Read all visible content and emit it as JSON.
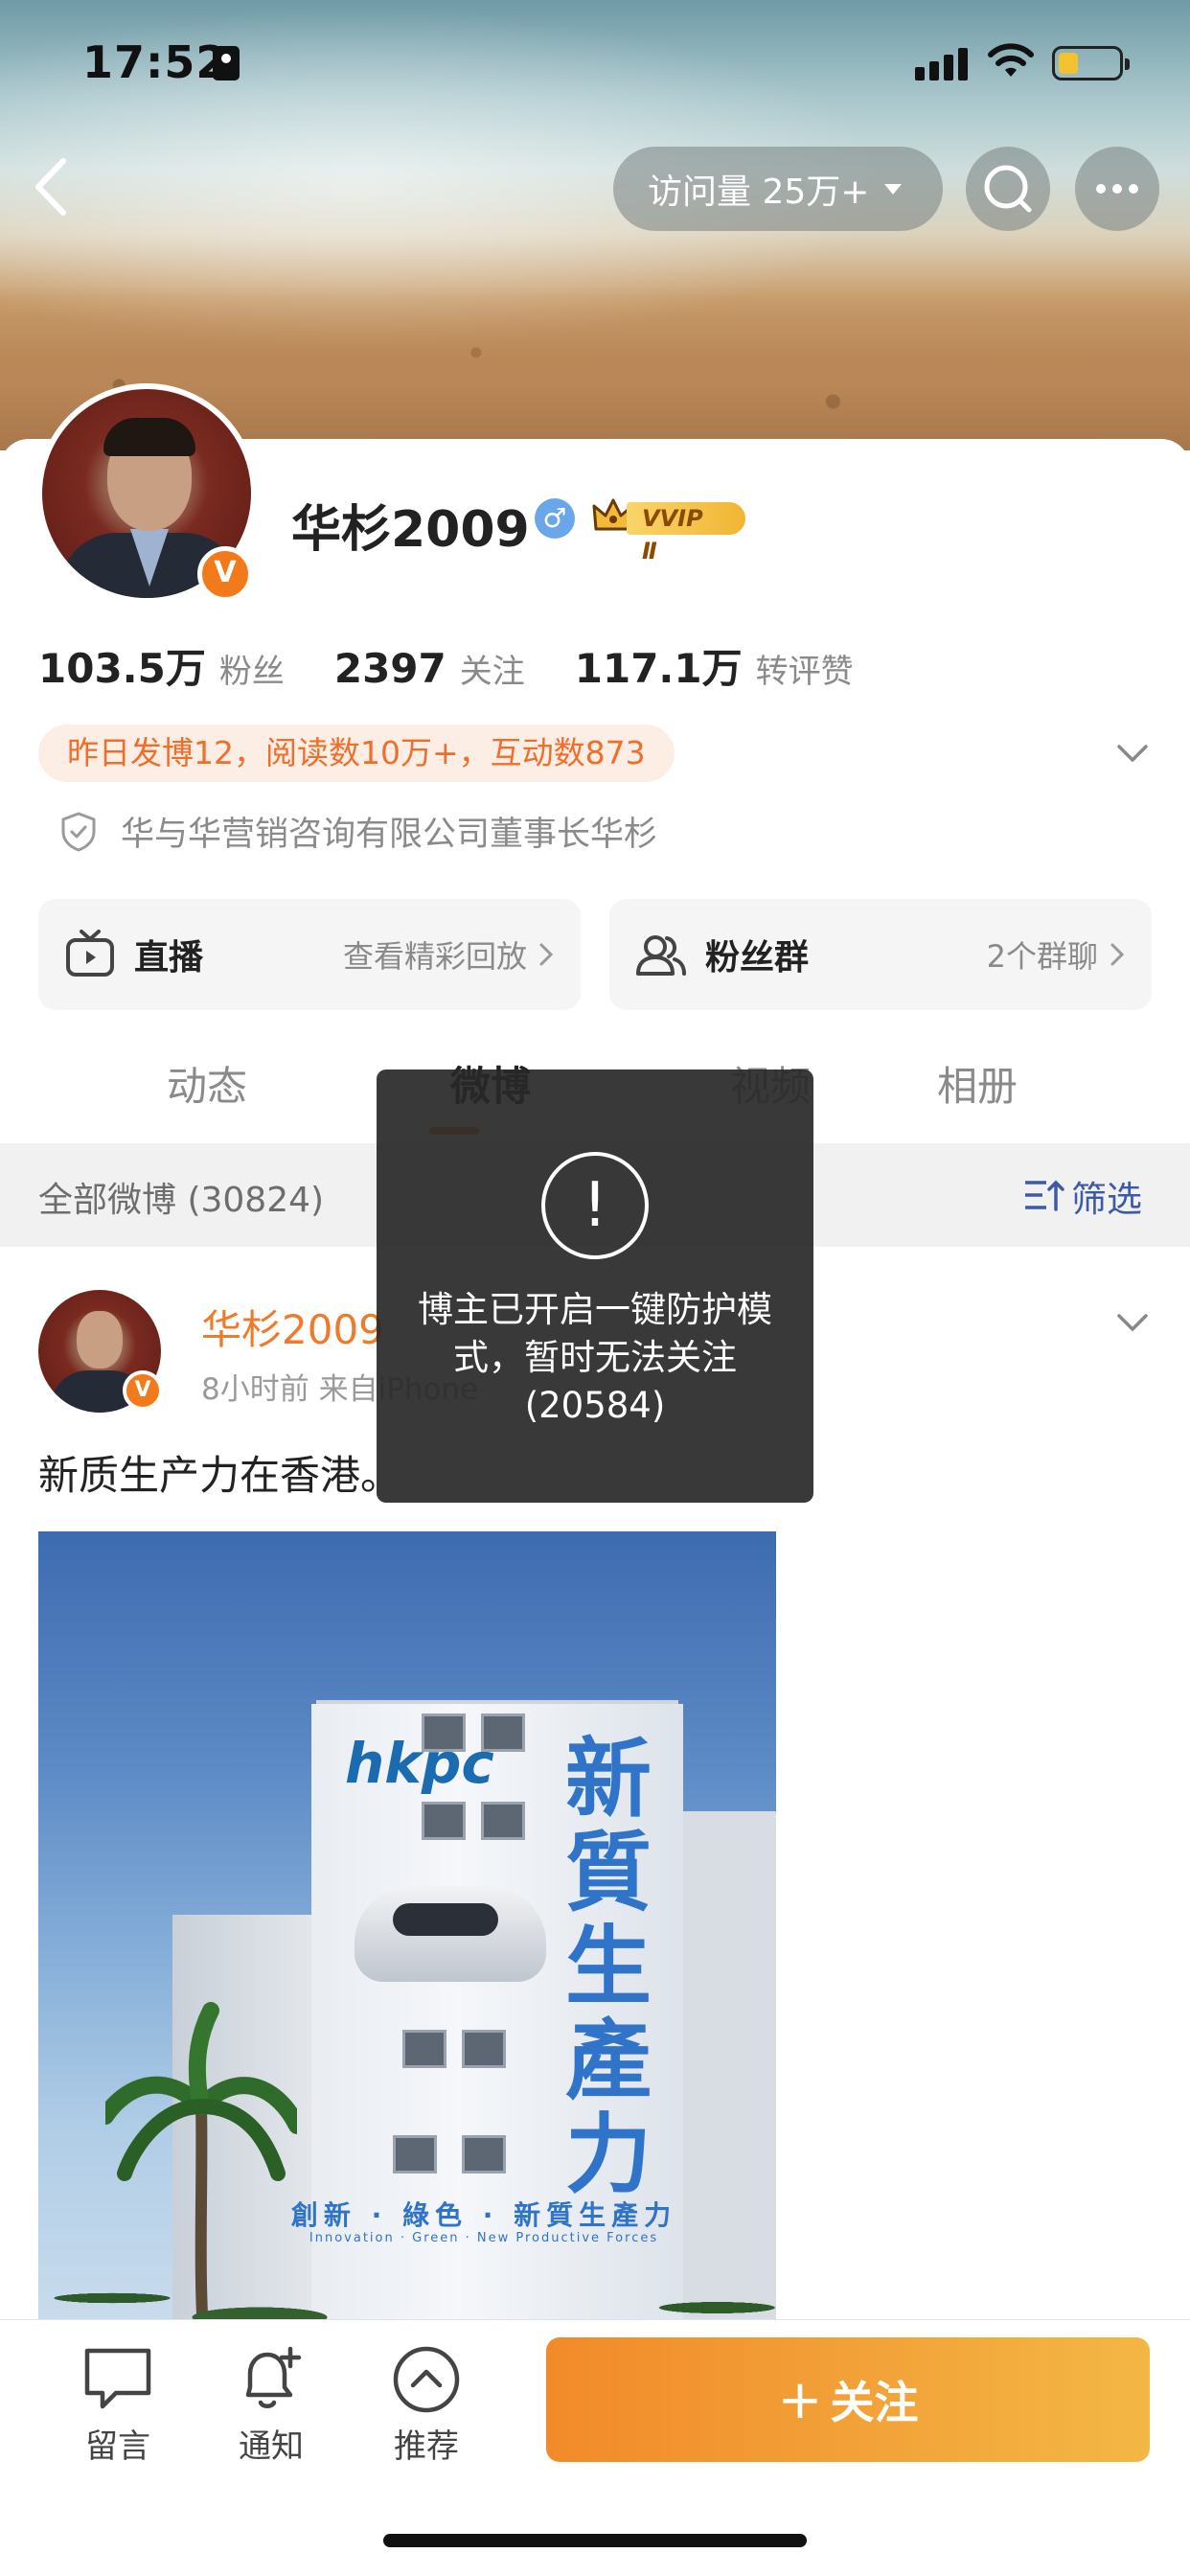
{
  "status_bar": {
    "time": "17:52"
  },
  "header": {
    "visits_label": "访问量 25万+"
  },
  "profile": {
    "username": "华杉2009",
    "gender_symbol": "♂",
    "vip_label": "VVIP Ⅱ",
    "verified_badge": "V",
    "stats": [
      {
        "value": "103.5万",
        "label": "粉丝"
      },
      {
        "value": "2397",
        "label": "关注"
      },
      {
        "value": "117.1万",
        "label": "转评赞"
      }
    ],
    "summary": "昨日发博12，阅读数10万+，互动数873",
    "verification": "华与华营销咨询有限公司董事长华杉"
  },
  "features": {
    "live": {
      "title": "直播",
      "sub": "查看精彩回放"
    },
    "fans_group": {
      "title": "粉丝群",
      "sub": "2个群聊"
    }
  },
  "tabs": [
    "动态",
    "微博",
    "视频",
    "相册"
  ],
  "filter_bar": {
    "all_label": "全部微博 (30824)",
    "filter_label": "筛选"
  },
  "post": {
    "author": "华杉2009",
    "meta": "8小时前  来自iPhone",
    "text": "新质生产力在香港。",
    "image": {
      "logo": "hkpc",
      "chars": [
        "新",
        "質",
        "生",
        "產",
        "力"
      ],
      "slogan": "創新 · 綠色 · 新質生產力",
      "slogan_en": "Innovation · Green · New Productive Forces"
    }
  },
  "toast": {
    "message": "博主已开启一键防护模式，暂时无法关注(20584)",
    "icon_glyph": "!"
  },
  "bottom_bar": {
    "items": [
      {
        "label": "留言"
      },
      {
        "label": "通知"
      },
      {
        "label": "推荐"
      }
    ],
    "follow_label": "关注",
    "follow_plus": "+"
  },
  "colors": {
    "accent_orange": "#ef7a2a",
    "filter_blue": "#3d5aa6",
    "follow_gradient_start": "#f28a2a",
    "follow_gradient_end": "#f3b745"
  }
}
